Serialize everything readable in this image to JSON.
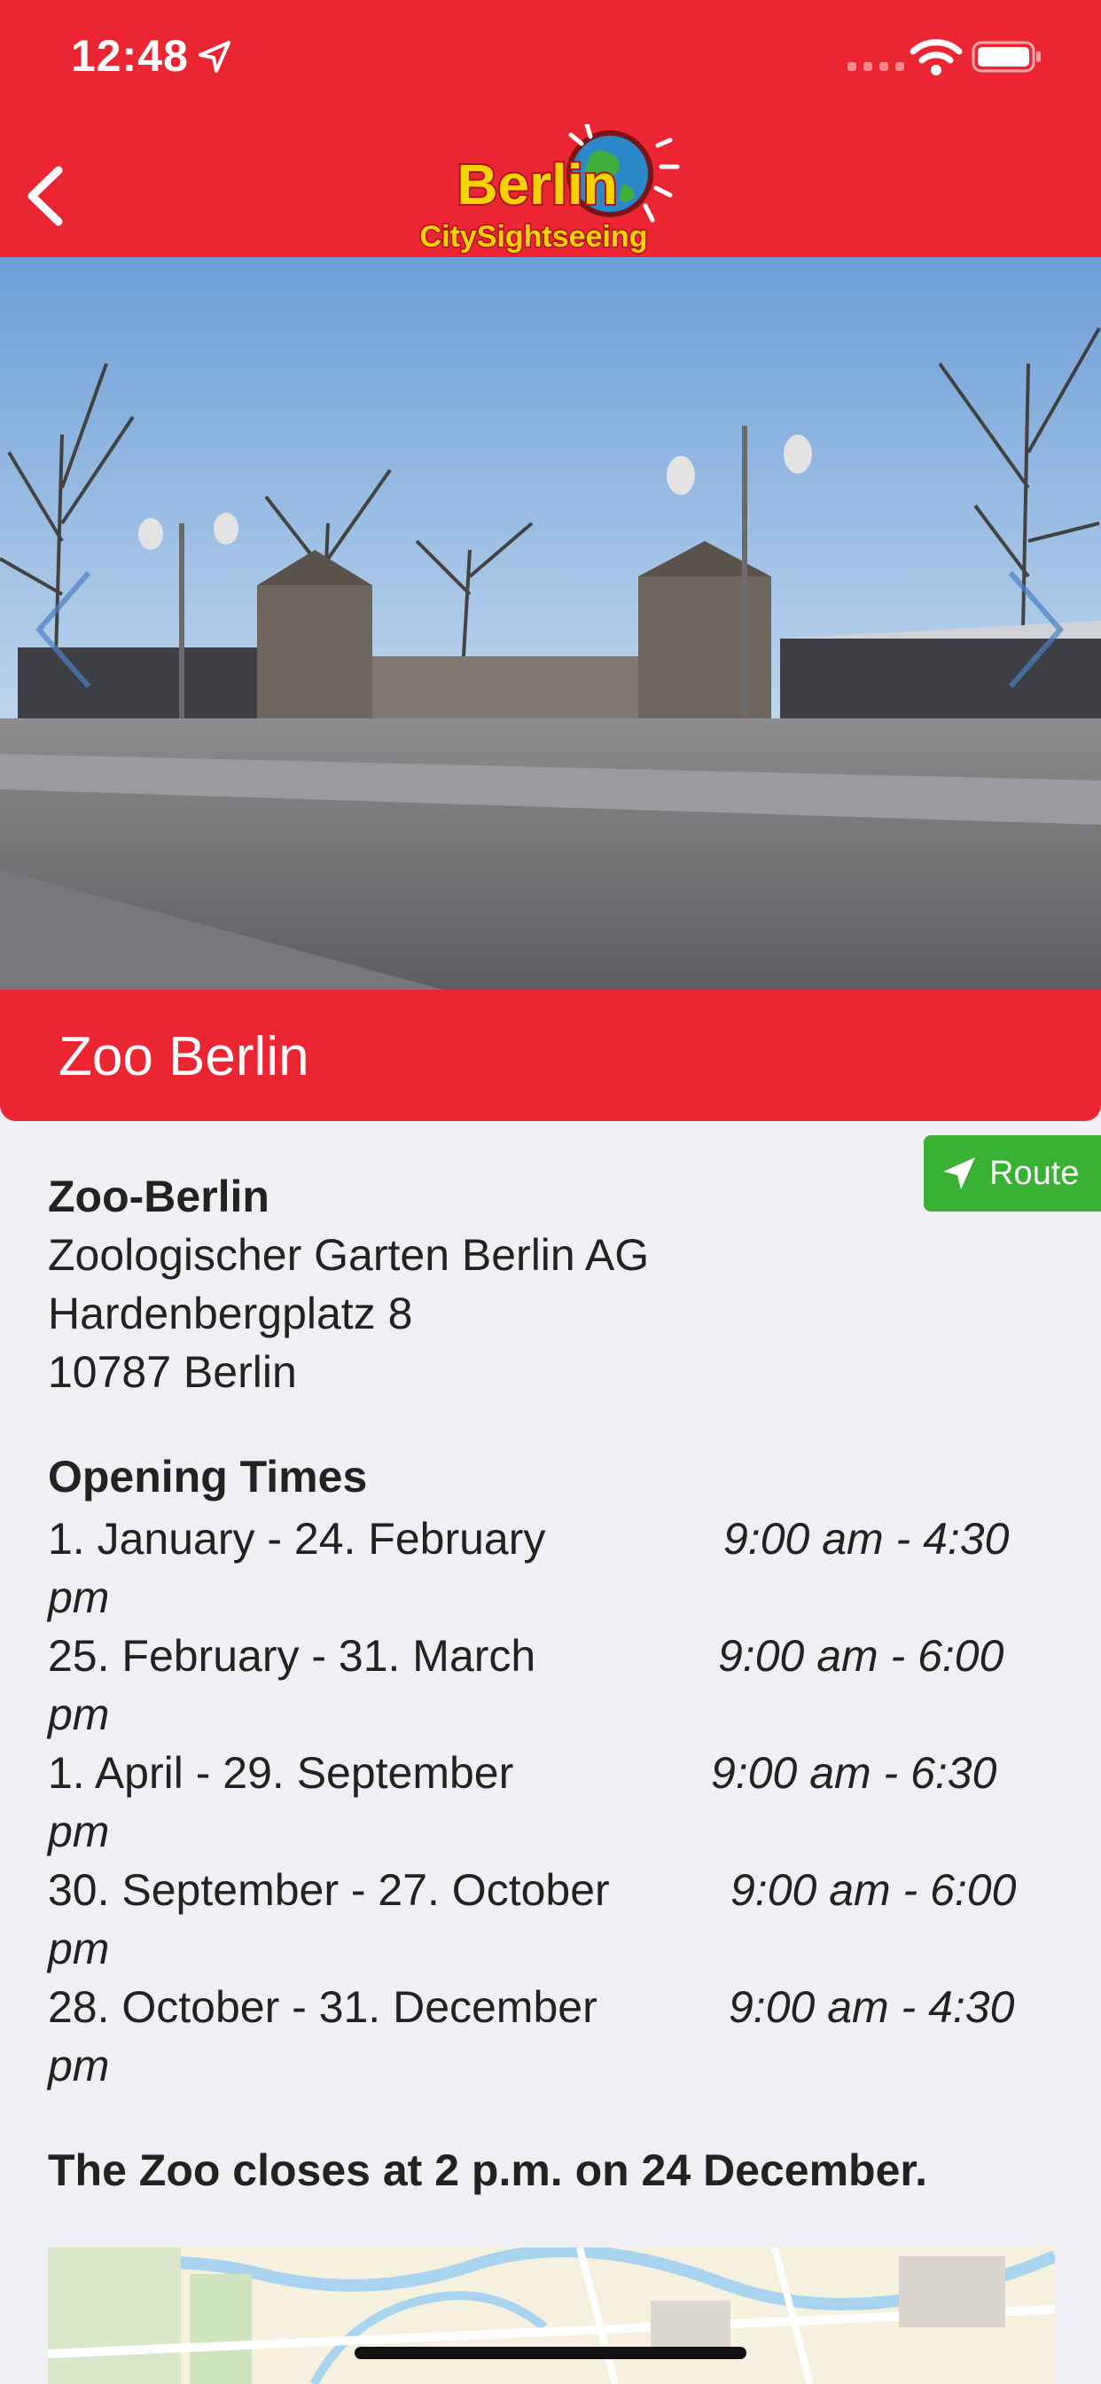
{
  "status": {
    "time": "12:48"
  },
  "header": {
    "logo_text_top": "Berlin",
    "logo_text_bottom": "CitySightseeing"
  },
  "place": {
    "title": "Zoo Berlin"
  },
  "route_button": {
    "label": "Route"
  },
  "address": {
    "name": "Zoo-Berlin",
    "line1": "Zoologischer Garten Berlin AG",
    "line2": "Hardenbergplatz 8",
    "line3": "10787 Berlin"
  },
  "opening": {
    "title": "Opening Times",
    "rows": [
      {
        "period": "1. January - 24. February",
        "time": "9:00 am - 4:30",
        "suffix": "pm"
      },
      {
        "period": "25. February - 31. March",
        "time": "9:00 am - 6:00",
        "suffix": "pm"
      },
      {
        "period": "1. April - 29. September",
        "time": "9:00 am - 6:30",
        "suffix": "pm"
      },
      {
        "period": "30. September - 27. October",
        "time": "9:00 am - 6:00",
        "suffix": "pm"
      },
      {
        "period": "28. October - 31. December",
        "time": "9:00 am - 4:30",
        "suffix": "pm"
      }
    ]
  },
  "note": "The Zoo closes at 2 p.m. on 24 December.",
  "colors": {
    "brand_red": "#ec2532",
    "route_green": "#38b135",
    "background": "#f0f0f4"
  }
}
